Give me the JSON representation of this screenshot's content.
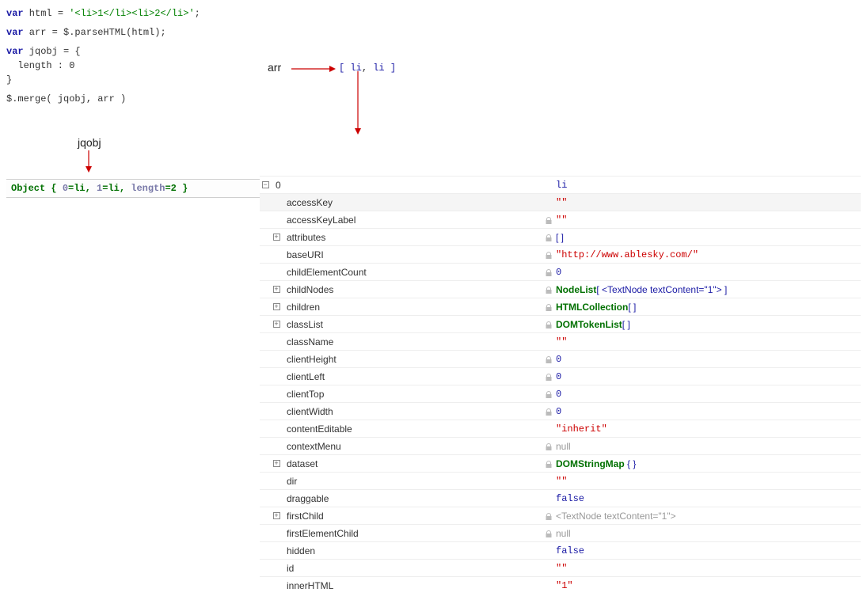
{
  "code": {
    "l1": {
      "kw": "var",
      "name": " html = ",
      "str": "'<li>1</li><li>2</li>'",
      "end": ";"
    },
    "l2": {
      "kw": "var",
      "rest": " arr = $.parseHTML(html);"
    },
    "l3": {
      "kw": "var",
      "rest": " jqobj = {"
    },
    "l4": "  length : 0",
    "l5": "}",
    "l6": "$.merge( jqobj, arr )"
  },
  "ann": {
    "arr_label": "arr",
    "arr_val_open": "[ ",
    "arr_val_item1": "li",
    "arr_val_sep": ", ",
    "arr_val_item2": "li",
    "arr_val_close": " ]",
    "jq_label": "jqobj"
  },
  "jq_result": {
    "prefix": "Object { ",
    "k0": "0",
    "v0": "li",
    "sep": ",  ",
    "k1": "1",
    "v1": "li",
    "k2": "length",
    "v2": "2",
    "suffix": " }"
  },
  "root_key": "0",
  "root_val": "li",
  "props": [
    {
      "key": "accessKey",
      "value": "\"\"",
      "vclass": "v-red",
      "lock": false,
      "tw": null,
      "zebra": true
    },
    {
      "key": "accessKeyLabel",
      "value": "\"\"",
      "vclass": "v-red",
      "lock": true,
      "tw": null
    },
    {
      "key": "attributes",
      "value": "[ ]",
      "vclass": "brkt",
      "lock": true,
      "tw": "+"
    },
    {
      "key": "baseURI",
      "value": "\"http://www.ablesky.com/\"",
      "vclass": "v-red",
      "lock": true,
      "tw": null
    },
    {
      "key": "childElementCount",
      "value": "0",
      "vclass": "v-blue",
      "lock": true,
      "tw": null
    },
    {
      "key": "childNodes",
      "value_html": "childNodes",
      "lock": true,
      "tw": "+"
    },
    {
      "key": "children",
      "value_html": "children",
      "lock": true,
      "tw": "+"
    },
    {
      "key": "classList",
      "value_html": "classList",
      "lock": true,
      "tw": "+"
    },
    {
      "key": "className",
      "value": "\"\"",
      "vclass": "v-red",
      "lock": false,
      "tw": null
    },
    {
      "key": "clientHeight",
      "value": "0",
      "vclass": "v-blue",
      "lock": true,
      "tw": null
    },
    {
      "key": "clientLeft",
      "value": "0",
      "vclass": "v-blue",
      "lock": true,
      "tw": null
    },
    {
      "key": "clientTop",
      "value": "0",
      "vclass": "v-blue",
      "lock": true,
      "tw": null
    },
    {
      "key": "clientWidth",
      "value": "0",
      "vclass": "v-blue",
      "lock": true,
      "tw": null
    },
    {
      "key": "contentEditable",
      "value": "\"inherit\"",
      "vclass": "v-red",
      "lock": false,
      "tw": null
    },
    {
      "key": "contextMenu",
      "value": "null",
      "vclass": "v-gray",
      "lock": true,
      "tw": null
    },
    {
      "key": "dataset",
      "value_html": "dataset",
      "lock": true,
      "tw": "+"
    },
    {
      "key": "dir",
      "value": "\"\"",
      "vclass": "v-red",
      "lock": false,
      "tw": null
    },
    {
      "key": "draggable",
      "value": "false",
      "vclass": "v-blue",
      "lock": false,
      "tw": null
    },
    {
      "key": "firstChild",
      "value_html": "firstChild",
      "lock": true,
      "tw": "+"
    },
    {
      "key": "firstElementChild",
      "value": "null",
      "vclass": "v-gray",
      "lock": true,
      "tw": null
    },
    {
      "key": "hidden",
      "value": "false",
      "vclass": "v-blue",
      "lock": false,
      "tw": null
    },
    {
      "key": "id",
      "value": "\"\"",
      "vclass": "v-red",
      "lock": false,
      "tw": null
    },
    {
      "key": "innerHTML",
      "value": "\"1\"",
      "vclass": "v-red",
      "lock": false,
      "tw": null
    }
  ],
  "complex": {
    "childNodes": {
      "t": "NodeList",
      "open": "[ ",
      "tag": "<TextNode textContent=\"1\">",
      "close": " ]"
    },
    "children": {
      "t": "HTMLCollection",
      "open": "[ ]"
    },
    "classList": {
      "t": "DOMTokenList",
      "open": "[ ]"
    },
    "dataset": {
      "t": "DOMStringMap",
      "open": " { }"
    },
    "firstChild": {
      "tag": "<TextNode textContent=\"1\">"
    }
  }
}
